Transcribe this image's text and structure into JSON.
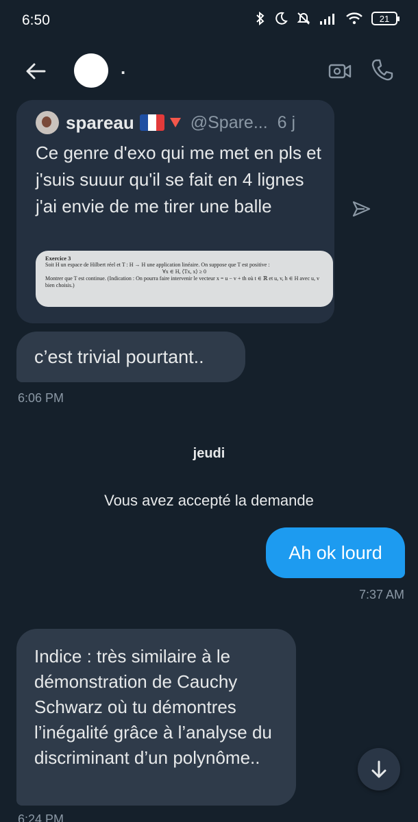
{
  "status_bar": {
    "time": "6:50",
    "battery": "21"
  },
  "header": {
    "contact_name": "."
  },
  "quoted_tweet": {
    "author": "spareau",
    "handle": "@Spare...",
    "age": "6 j",
    "text": "Ce genre d'exo qui me met en pls et j'suis suuur qu'il se fait en 4 lignes j'ai envie de me tirer une balle",
    "image": {
      "title": "Exercice 3",
      "line1": "Soit H un espace de Hilbert réel et T : H → H une application linéaire. On suppose que T est positive :",
      "formula": "∀x ∈ H,   ⟨Tx, x⟩ ≥ 0",
      "line2": "Montrer que T est continue. (Indication : On pourra faire intervenir le vecteur x = u − v + th où t ∈ ℝ et u, v, h ∈ H avec u, v bien choisis.)"
    }
  },
  "messages": {
    "m1": {
      "text": "c’est trivial pourtant..",
      "time": "6:06 PM"
    },
    "day_label": "jeudi",
    "system": "Vous avez accepté la demande",
    "m2": {
      "text": "Ah ok lourd",
      "time": "7:37 AM"
    },
    "m3": {
      "text": "Indice : très similaire à le démonstration de Cauchy Schwarz où tu démontres l’inégalité grâce à l’analyse du discriminant d’un polynôme..",
      "time": "6:24 PM"
    }
  },
  "colors": {
    "background": "#15202b",
    "bubble_in": "#2f3b4a",
    "bubble_out": "#1d9bf0",
    "quote_card": "#243040"
  }
}
